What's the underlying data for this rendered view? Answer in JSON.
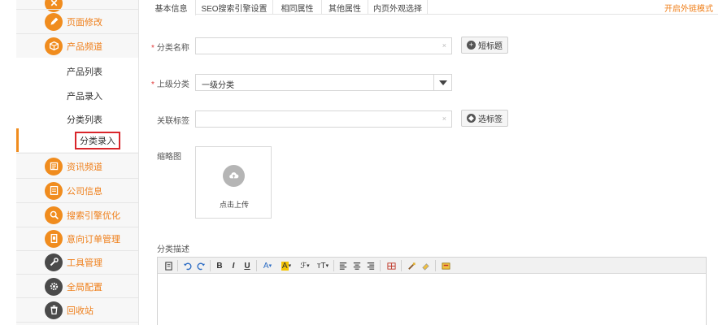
{
  "sidebar": {
    "items": [
      {
        "label": "页面修改"
      },
      {
        "label": "产品频道"
      },
      {
        "label": "资讯频道"
      },
      {
        "label": "公司信息"
      },
      {
        "label": "搜索引擎优化"
      },
      {
        "label": "意向订单管理"
      },
      {
        "label": "工具管理"
      },
      {
        "label": "全局配置"
      },
      {
        "label": "回收站"
      }
    ],
    "sub_items": [
      {
        "label": "产品列表"
      },
      {
        "label": "产品录入"
      },
      {
        "label": "分类列表"
      },
      {
        "label": "分类录入"
      }
    ],
    "accent_color": "#f08c1e"
  },
  "tabs": [
    {
      "label": "基本信息"
    },
    {
      "label": "SEO搜索引擎设置"
    },
    {
      "label": "相同属性"
    },
    {
      "label": "其他属性"
    },
    {
      "label": "内页外观选择"
    }
  ],
  "tab_link": "开启外链模式",
  "form": {
    "category_name_label": "分类名称",
    "category_name_value": "",
    "short_title_button": "短标题",
    "parent_label": "上级分类",
    "parent_value": "一级分类",
    "tags_label": "关联标签",
    "tags_value": "",
    "select_tags_button": "选标签",
    "thumbnail_label": "缩略图",
    "upload_text": "点击上传",
    "description_label": "分类描述",
    "clear_glyph": "×"
  },
  "editor_toolbar": {
    "bold": "B",
    "italic": "I",
    "underline": "U",
    "font_color": "A",
    "highlight": "A",
    "font_size": "тT"
  }
}
